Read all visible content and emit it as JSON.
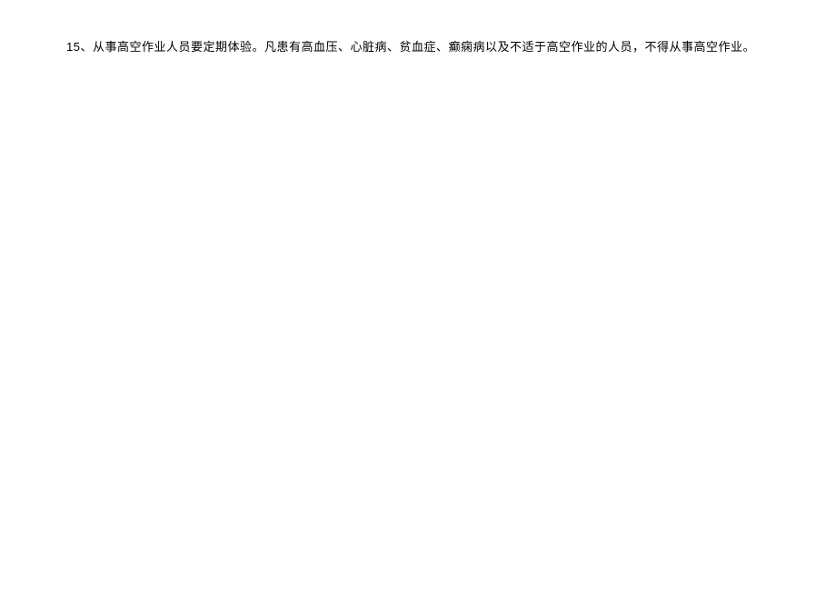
{
  "document": {
    "item_number": "15",
    "separator": "、",
    "text": "从事高空作业人员要定期体验。凡患有高血压、心脏病、贫血症、癫痫病以及不适于高空作业的人员，不得从事高空作业。"
  }
}
